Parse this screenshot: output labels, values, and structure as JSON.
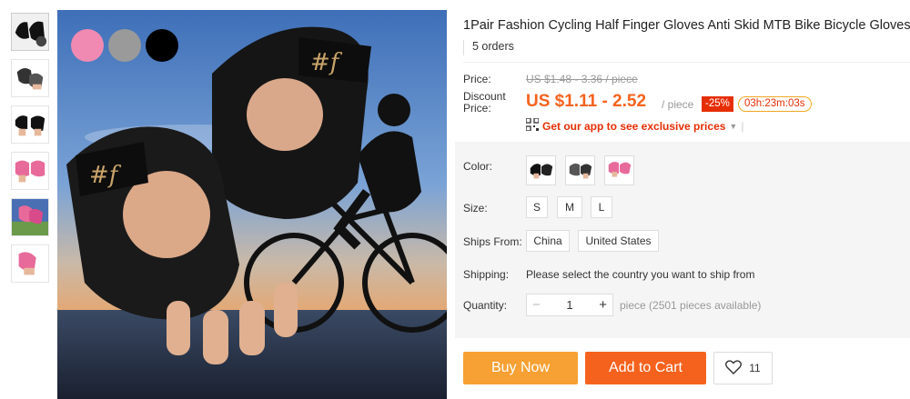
{
  "product": {
    "title": "1Pair Fashion Cycling Half Finger Gloves Anti Skid MTB Bike Bicycle Gloves",
    "orders": "5 orders"
  },
  "image_swatches": {
    "colors": [
      "#f18ab2",
      "#9a9a9a",
      "#000000"
    ]
  },
  "pricing": {
    "price_label": "Price:",
    "original_price": "US $1.48 - 3.36 / piece",
    "discount_label": "Discount Price:",
    "discount_price": "US $1.11 - 2.52",
    "per_piece": "/ piece",
    "discount_badge": "-25%",
    "timer": "03h:23m:03s",
    "app_link": "Get our app to see exclusive prices"
  },
  "options": {
    "color_label": "Color:",
    "size_label": "Size:",
    "sizes": [
      "S",
      "M",
      "L"
    ],
    "ships_from_label": "Ships From:",
    "ships_from": [
      "China",
      "United States"
    ],
    "shipping_label": "Shipping:",
    "shipping_text": "Please select the country you want to ship from",
    "quantity_label": "Quantity:",
    "quantity_value": "1",
    "quantity_minus": "−",
    "quantity_plus": "+",
    "quantity_available": "piece (2501 pieces available)"
  },
  "actions": {
    "buy_now": "Buy Now",
    "add_to_cart": "Add to Cart",
    "wishlist_count": "11"
  },
  "theme": {
    "orange": "#f5621e",
    "buy_now_color": "#f7a033",
    "badge_red": "#e62e04"
  }
}
